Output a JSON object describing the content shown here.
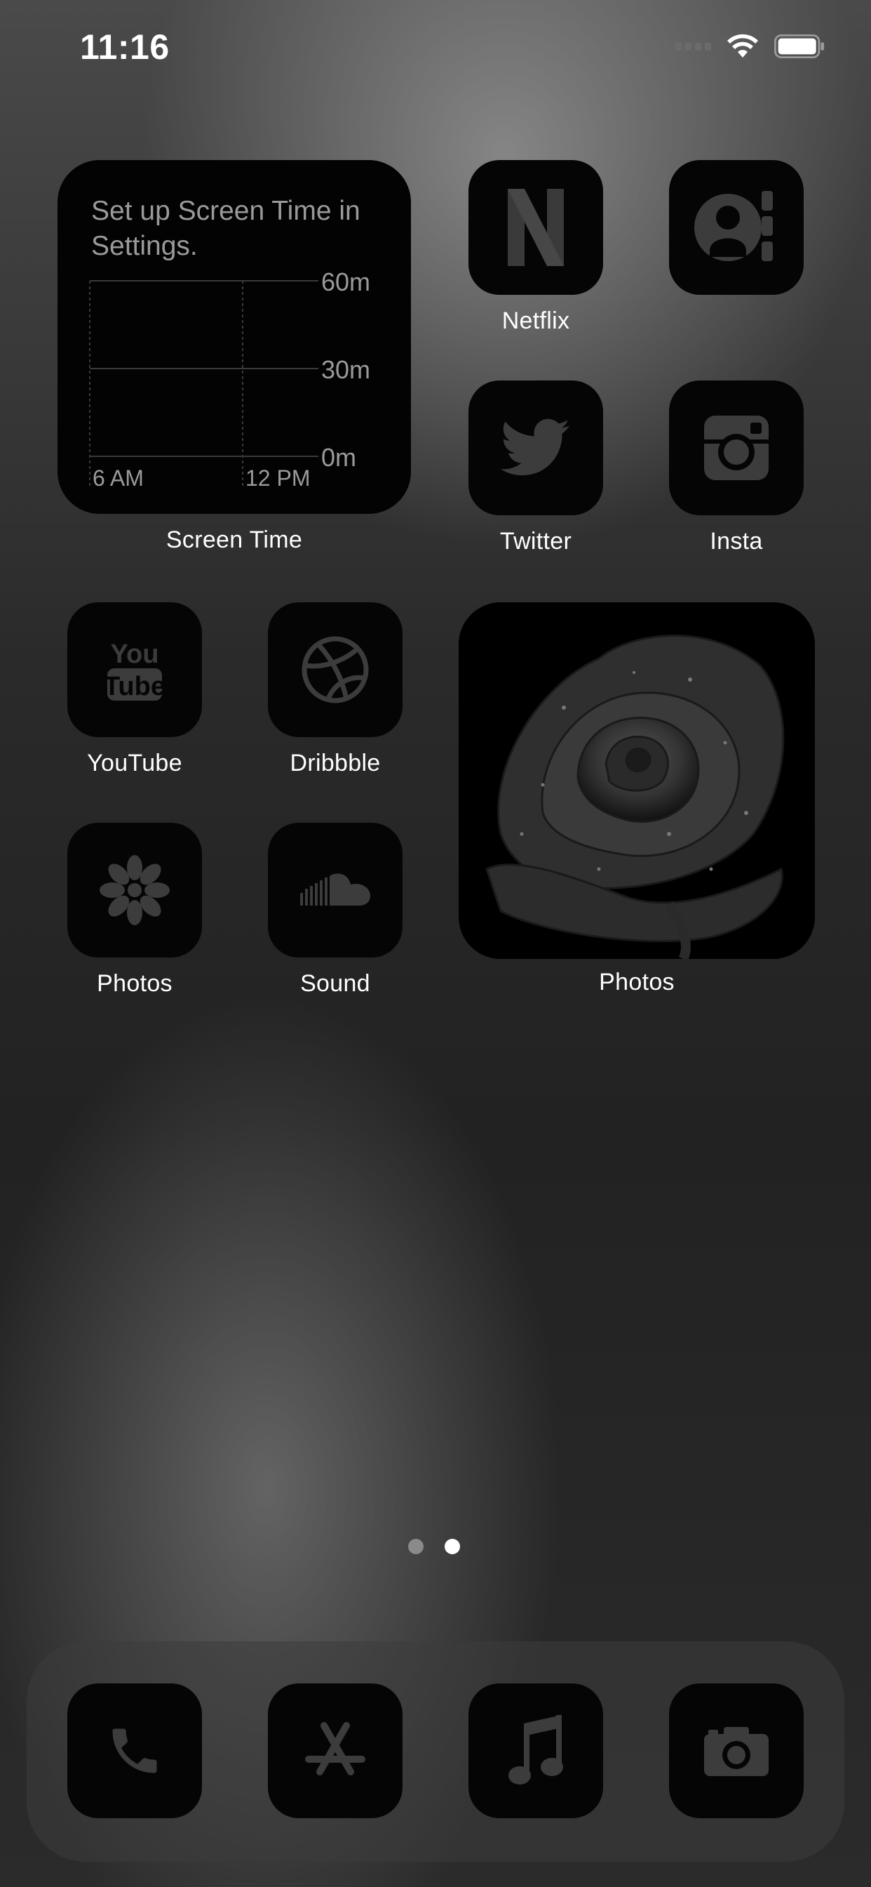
{
  "status_bar": {
    "time": "11:16"
  },
  "screen_time_widget": {
    "title": "Set up Screen Time in Settings.",
    "label": "Screen Time",
    "y_ticks": [
      "60m",
      "30m",
      "0m"
    ],
    "x_ticks": [
      "6 AM",
      "12 PM"
    ]
  },
  "apps": {
    "netflix": {
      "label": "Netflix",
      "icon": "netflix-n-icon"
    },
    "contacts": {
      "label": "",
      "icon": "contacts-icon"
    },
    "twitter": {
      "label": "Twitter",
      "icon": "twitter-bird-icon"
    },
    "insta": {
      "label": "Insta",
      "icon": "instagram-camera-icon"
    },
    "youtube": {
      "label": "YouTube",
      "icon": "youtube-logo-icon"
    },
    "dribbble": {
      "label": "Dribbble",
      "icon": "dribbble-ball-icon"
    },
    "photos": {
      "label": "Photos",
      "icon": "photos-flower-icon"
    },
    "sound": {
      "label": "Sound",
      "icon": "soundcloud-icon"
    }
  },
  "photo_widget": {
    "label": "Photos",
    "image": "rose-photo"
  },
  "page_indicator": {
    "count": 2,
    "current": 2
  },
  "dock": [
    {
      "name": "phone",
      "icon": "phone-handset-icon"
    },
    {
      "name": "app-store",
      "icon": "app-store-icon"
    },
    {
      "name": "music",
      "icon": "music-note-icon"
    },
    {
      "name": "camera",
      "icon": "camera-icon"
    }
  ],
  "colors": {
    "tile_bg": "#050505",
    "icon_gray": "#3c3c3c",
    "label_white": "#ffffff",
    "dot_active": "#ffffff",
    "dot_inactive": "#8a8a8a"
  }
}
